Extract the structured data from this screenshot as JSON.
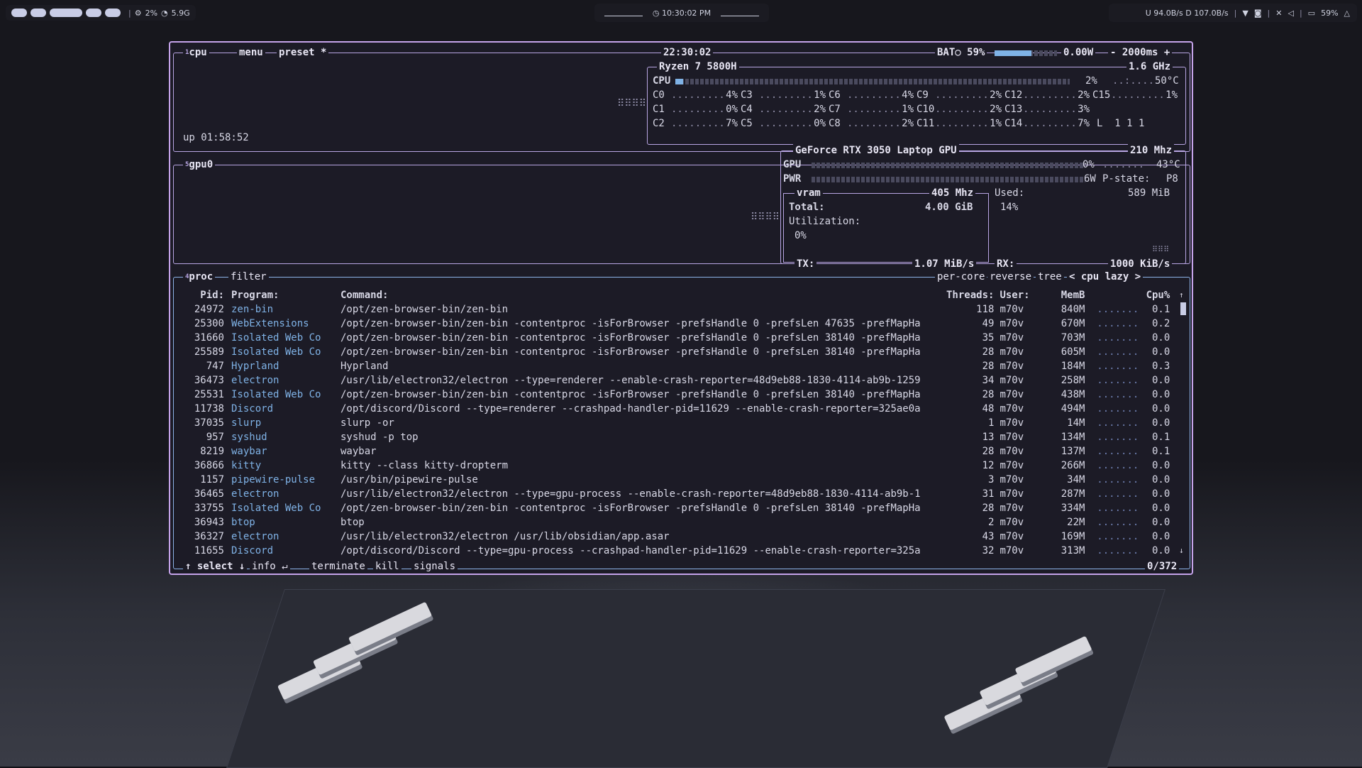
{
  "topbar": {
    "cpu_pct": "2%",
    "mem": "5.9G",
    "clock": "10:30:02 PM",
    "net": "U 94.0B/s D 107.0B/s",
    "battery": "59%"
  },
  "cpu": {
    "header": {
      "num": "1",
      "title": "cpu",
      "menu": "menu",
      "preset": "preset *",
      "time": "22:30:02",
      "bat_label": "BAT○ 59%",
      "power": "0.00W",
      "interval": "- 2000ms +"
    },
    "uptime": "up 01:58:52",
    "model": "Ryzen 7 5800H",
    "freq": "1.6 GHz",
    "total_label": "CPU",
    "total_pct": "2%",
    "temp": "50°C",
    "total_fill": 0.02,
    "cores": [
      {
        "name": "C0",
        "pct": "4%"
      },
      {
        "name": "C1",
        "pct": "0%"
      },
      {
        "name": "C2",
        "pct": "7%"
      },
      {
        "name": "C3",
        "pct": "1%"
      },
      {
        "name": "C4",
        "pct": "2%"
      },
      {
        "name": "C5",
        "pct": "0%"
      },
      {
        "name": "C6",
        "pct": "4%"
      },
      {
        "name": "C7",
        "pct": "1%"
      },
      {
        "name": "C8",
        "pct": "2%"
      },
      {
        "name": "C9",
        "pct": "2%"
      },
      {
        "name": "C10",
        "pct": "2%"
      },
      {
        "name": "C11",
        "pct": "1%"
      },
      {
        "name": "C12",
        "pct": "2%"
      },
      {
        "name": "C13",
        "pct": "3%"
      },
      {
        "name": "C14",
        "pct": "7%"
      },
      {
        "name": "C15",
        "pct": "1%"
      }
    ],
    "load": "L  1 1 1"
  },
  "gpu": {
    "header": {
      "num": "5",
      "title": "gpu0"
    },
    "model": "GeForce RTX 3050 Laptop GPU",
    "clock": "210 Mhz",
    "gpu_label": "GPU",
    "gpu_pct": "0%",
    "gpu_temp": "43°C",
    "pwr_label": "PWR",
    "pwr_val": "6W",
    "pstate_label": "P-state:",
    "pstate": "P8",
    "vram_title": "vram",
    "vram_clock": "405 Mhz",
    "total_label": "Total:",
    "total_val": "4.00 GiB",
    "used_label": "Used:",
    "used_val": "589 MiB",
    "used_pct": "14%",
    "util_label": "Utilization:",
    "util_val": "0%",
    "tx_label": "TX:",
    "tx_val": "1.07 MiB/s",
    "rx_label": "RX:",
    "rx_val": "1000 KiB/s"
  },
  "proc": {
    "header": {
      "num": "4",
      "title": "proc",
      "filter": "filter",
      "percore": "per-core",
      "reverse": "reverse",
      "tree": "tree",
      "sort": "< cpu lazy >"
    },
    "columns": {
      "pid": "Pid:",
      "program": "Program:",
      "command": "Command:",
      "threads": "Threads:",
      "user": "User:",
      "mem": "MemB",
      "cpu": "Cpu%"
    },
    "rows": [
      {
        "pid": "24972",
        "program": "zen-bin",
        "command": "/opt/zen-browser-bin/zen-bin",
        "threads": "118",
        "user": "m70v",
        "mem": "840M",
        "cpu": "0.1"
      },
      {
        "pid": "25300",
        "program": "WebExtensions",
        "command": "/opt/zen-browser-bin/zen-bin -contentproc -isForBrowser -prefsHandle 0 -prefsLen 47635 -prefMapHa",
        "threads": "49",
        "user": "m70v",
        "mem": "670M",
        "cpu": "0.2"
      },
      {
        "pid": "31660",
        "program": "Isolated Web Co",
        "command": "/opt/zen-browser-bin/zen-bin -contentproc -isForBrowser -prefsHandle 0 -prefsLen 38140 -prefMapHa",
        "threads": "35",
        "user": "m70v",
        "mem": "703M",
        "cpu": "0.0"
      },
      {
        "pid": "25589",
        "program": "Isolated Web Co",
        "command": "/opt/zen-browser-bin/zen-bin -contentproc -isForBrowser -prefsHandle 0 -prefsLen 38140 -prefMapHa",
        "threads": "28",
        "user": "m70v",
        "mem": "605M",
        "cpu": "0.0"
      },
      {
        "pid": "747",
        "program": "Hyprland",
        "command": "Hyprland",
        "threads": "28",
        "user": "m70v",
        "mem": "184M",
        "cpu": "0.3"
      },
      {
        "pid": "36473",
        "program": "electron",
        "command": "/usr/lib/electron32/electron --type=renderer --enable-crash-reporter=48d9eb88-1830-4114-ab9b-1259",
        "threads": "34",
        "user": "m70v",
        "mem": "258M",
        "cpu": "0.0"
      },
      {
        "pid": "25531",
        "program": "Isolated Web Co",
        "command": "/opt/zen-browser-bin/zen-bin -contentproc -isForBrowser -prefsHandle 0 -prefsLen 38140 -prefMapHa",
        "threads": "28",
        "user": "m70v",
        "mem": "438M",
        "cpu": "0.0"
      },
      {
        "pid": "11738",
        "program": "Discord",
        "command": "/opt/discord/Discord --type=renderer --crashpad-handler-pid=11629 --enable-crash-reporter=325ae0a",
        "threads": "48",
        "user": "m70v",
        "mem": "494M",
        "cpu": "0.0"
      },
      {
        "pid": "37035",
        "program": "slurp",
        "command": "slurp -or",
        "threads": "1",
        "user": "m70v",
        "mem": "14M",
        "cpu": "0.0"
      },
      {
        "pid": "957",
        "program": "syshud",
        "command": "syshud -p top",
        "threads": "13",
        "user": "m70v",
        "mem": "134M",
        "cpu": "0.1"
      },
      {
        "pid": "8219",
        "program": "waybar",
        "command": "waybar",
        "threads": "28",
        "user": "m70v",
        "mem": "137M",
        "cpu": "0.1"
      },
      {
        "pid": "36866",
        "program": "kitty",
        "command": "kitty --class kitty-dropterm",
        "threads": "12",
        "user": "m70v",
        "mem": "266M",
        "cpu": "0.0"
      },
      {
        "pid": "1157",
        "program": "pipewire-pulse",
        "command": "/usr/bin/pipewire-pulse",
        "threads": "3",
        "user": "m70v",
        "mem": "34M",
        "cpu": "0.0"
      },
      {
        "pid": "36465",
        "program": "electron",
        "command": "/usr/lib/electron32/electron --type=gpu-process --enable-crash-reporter=48d9eb88-1830-4114-ab9b-1",
        "threads": "31",
        "user": "m70v",
        "mem": "287M",
        "cpu": "0.0"
      },
      {
        "pid": "33755",
        "program": "Isolated Web Co",
        "command": "/opt/zen-browser-bin/zen-bin -contentproc -isForBrowser -prefsHandle 0 -prefsLen 38140 -prefMapHa",
        "threads": "28",
        "user": "m70v",
        "mem": "334M",
        "cpu": "0.0"
      },
      {
        "pid": "36943",
        "program": "btop",
        "command": "btop",
        "threads": "2",
        "user": "m70v",
        "mem": "22M",
        "cpu": "0.0"
      },
      {
        "pid": "36327",
        "program": "electron",
        "command": "/usr/lib/electron32/electron /usr/lib/obsidian/app.asar",
        "threads": "43",
        "user": "m70v",
        "mem": "169M",
        "cpu": "0.0"
      },
      {
        "pid": "11655",
        "program": "Discord",
        "command": "/opt/discord/Discord --type=gpu-process --crashpad-handler-pid=11629 --enable-crash-reporter=325a",
        "threads": "32",
        "user": "m70v",
        "mem": "313M",
        "cpu": "0.0"
      }
    ],
    "footer": {
      "select": "select",
      "info": "info",
      "terminate": "terminate",
      "kill": "kill",
      "signals": "signals",
      "count": "0/372"
    }
  },
  "colors": {
    "border": "#c5a3ea",
    "accent": "#7fb2e6",
    "bg": "#1c1b26"
  }
}
